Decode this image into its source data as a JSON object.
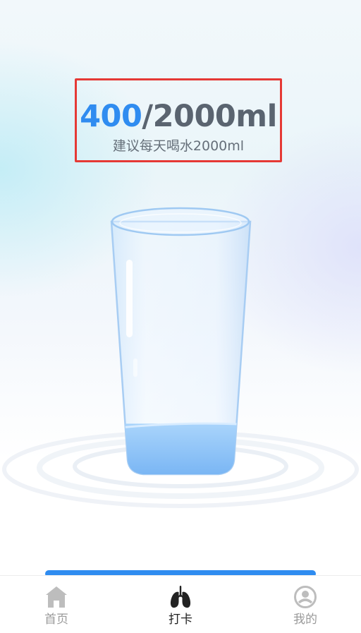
{
  "intake": {
    "current_ml": "400",
    "separator_and_goal": "/2000ml",
    "hint": "建议每天喝水2000ml",
    "fill_fraction": 0.2
  },
  "tabbar": {
    "tabs": [
      {
        "label": "首页",
        "icon": "home-icon",
        "active": false
      },
      {
        "label": "打卡",
        "icon": "lungs-icon",
        "active": true
      },
      {
        "label": "我的",
        "icon": "profile-icon",
        "active": false
      }
    ]
  },
  "colors": {
    "accent": "#2f8cf0",
    "highlight_border": "#e53935",
    "water": "#8ec3f7",
    "text_primary": "#5a6470"
  }
}
